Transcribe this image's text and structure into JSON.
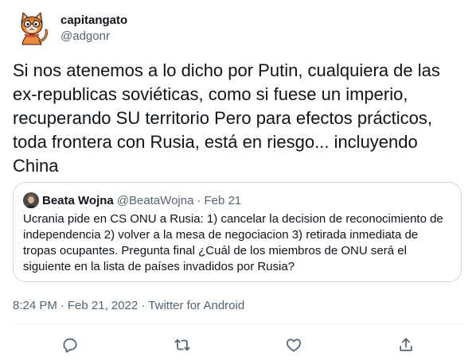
{
  "author": {
    "display_name": "capitangato",
    "handle": "@adgonr",
    "avatar_icon": "orange-cat-cartoon-avatar"
  },
  "tweet": {
    "text": "Si nos atenemos a lo dicho por Putin, cualquiera de las ex-republicas soviéticas, como si fuese un imperio, recuperando SU territorio Pero para efectos prácticos, toda frontera con Rusia, está en riesgo... incluyendo China"
  },
  "quoted_tweet": {
    "display_name": "Beata Wojna",
    "handle": "@BeataWojna",
    "separator": "·",
    "date": "Feb 21",
    "text": "Ucrania pide en CS ONU a Rusia: 1) cancelar la decision de reconocimiento de independencia 2) volver a la mesa de negociacion 3) retirada inmediata de tropas ocupantes. Pregunta final ¿Cuál de los miembros de ONU será el siguiente en la lista de países invadidos por Rusia?"
  },
  "meta": {
    "time": "8:24 PM",
    "separator_1": "·",
    "date": "Feb 21, 2022",
    "separator_2": "·",
    "source": "Twitter for Android"
  },
  "actions": [
    {
      "icon": "reply-icon"
    },
    {
      "icon": "retweet-icon"
    },
    {
      "icon": "like-icon"
    },
    {
      "icon": "share-icon"
    }
  ],
  "colors": {
    "text_primary": "#0f1419",
    "text_secondary": "#536471",
    "border": "#cfd9de",
    "divider": "#eff3f4",
    "icon": "#536471"
  }
}
